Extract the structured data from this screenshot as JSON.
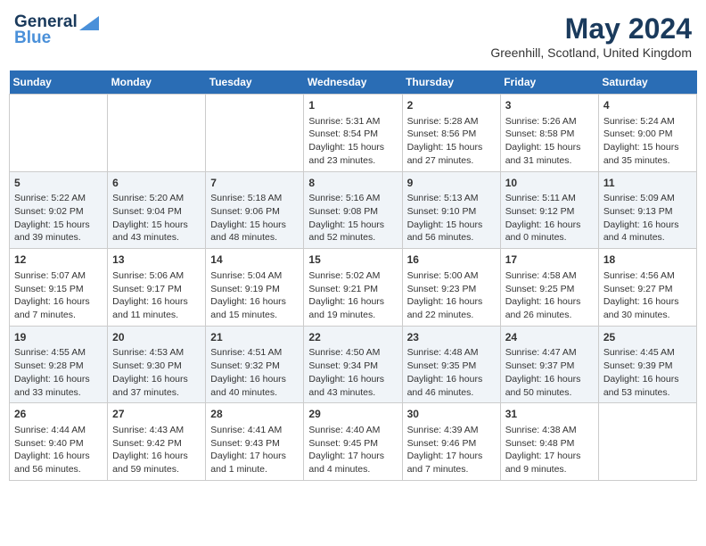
{
  "app": {
    "logo_general": "General",
    "logo_blue": "Blue",
    "title": "May 2024",
    "location": "Greenhill, Scotland, United Kingdom"
  },
  "calendar": {
    "headers": [
      "Sunday",
      "Monday",
      "Tuesday",
      "Wednesday",
      "Thursday",
      "Friday",
      "Saturday"
    ],
    "weeks": [
      [
        {
          "day": "",
          "info": ""
        },
        {
          "day": "",
          "info": ""
        },
        {
          "day": "",
          "info": ""
        },
        {
          "day": "1",
          "info": "Sunrise: 5:31 AM\nSunset: 8:54 PM\nDaylight: 15 hours\nand 23 minutes."
        },
        {
          "day": "2",
          "info": "Sunrise: 5:28 AM\nSunset: 8:56 PM\nDaylight: 15 hours\nand 27 minutes."
        },
        {
          "day": "3",
          "info": "Sunrise: 5:26 AM\nSunset: 8:58 PM\nDaylight: 15 hours\nand 31 minutes."
        },
        {
          "day": "4",
          "info": "Sunrise: 5:24 AM\nSunset: 9:00 PM\nDaylight: 15 hours\nand 35 minutes."
        }
      ],
      [
        {
          "day": "5",
          "info": "Sunrise: 5:22 AM\nSunset: 9:02 PM\nDaylight: 15 hours\nand 39 minutes."
        },
        {
          "day": "6",
          "info": "Sunrise: 5:20 AM\nSunset: 9:04 PM\nDaylight: 15 hours\nand 43 minutes."
        },
        {
          "day": "7",
          "info": "Sunrise: 5:18 AM\nSunset: 9:06 PM\nDaylight: 15 hours\nand 48 minutes."
        },
        {
          "day": "8",
          "info": "Sunrise: 5:16 AM\nSunset: 9:08 PM\nDaylight: 15 hours\nand 52 minutes."
        },
        {
          "day": "9",
          "info": "Sunrise: 5:13 AM\nSunset: 9:10 PM\nDaylight: 15 hours\nand 56 minutes."
        },
        {
          "day": "10",
          "info": "Sunrise: 5:11 AM\nSunset: 9:12 PM\nDaylight: 16 hours\nand 0 minutes."
        },
        {
          "day": "11",
          "info": "Sunrise: 5:09 AM\nSunset: 9:13 PM\nDaylight: 16 hours\nand 4 minutes."
        }
      ],
      [
        {
          "day": "12",
          "info": "Sunrise: 5:07 AM\nSunset: 9:15 PM\nDaylight: 16 hours\nand 7 minutes."
        },
        {
          "day": "13",
          "info": "Sunrise: 5:06 AM\nSunset: 9:17 PM\nDaylight: 16 hours\nand 11 minutes."
        },
        {
          "day": "14",
          "info": "Sunrise: 5:04 AM\nSunset: 9:19 PM\nDaylight: 16 hours\nand 15 minutes."
        },
        {
          "day": "15",
          "info": "Sunrise: 5:02 AM\nSunset: 9:21 PM\nDaylight: 16 hours\nand 19 minutes."
        },
        {
          "day": "16",
          "info": "Sunrise: 5:00 AM\nSunset: 9:23 PM\nDaylight: 16 hours\nand 22 minutes."
        },
        {
          "day": "17",
          "info": "Sunrise: 4:58 AM\nSunset: 9:25 PM\nDaylight: 16 hours\nand 26 minutes."
        },
        {
          "day": "18",
          "info": "Sunrise: 4:56 AM\nSunset: 9:27 PM\nDaylight: 16 hours\nand 30 minutes."
        }
      ],
      [
        {
          "day": "19",
          "info": "Sunrise: 4:55 AM\nSunset: 9:28 PM\nDaylight: 16 hours\nand 33 minutes."
        },
        {
          "day": "20",
          "info": "Sunrise: 4:53 AM\nSunset: 9:30 PM\nDaylight: 16 hours\nand 37 minutes."
        },
        {
          "day": "21",
          "info": "Sunrise: 4:51 AM\nSunset: 9:32 PM\nDaylight: 16 hours\nand 40 minutes."
        },
        {
          "day": "22",
          "info": "Sunrise: 4:50 AM\nSunset: 9:34 PM\nDaylight: 16 hours\nand 43 minutes."
        },
        {
          "day": "23",
          "info": "Sunrise: 4:48 AM\nSunset: 9:35 PM\nDaylight: 16 hours\nand 46 minutes."
        },
        {
          "day": "24",
          "info": "Sunrise: 4:47 AM\nSunset: 9:37 PM\nDaylight: 16 hours\nand 50 minutes."
        },
        {
          "day": "25",
          "info": "Sunrise: 4:45 AM\nSunset: 9:39 PM\nDaylight: 16 hours\nand 53 minutes."
        }
      ],
      [
        {
          "day": "26",
          "info": "Sunrise: 4:44 AM\nSunset: 9:40 PM\nDaylight: 16 hours\nand 56 minutes."
        },
        {
          "day": "27",
          "info": "Sunrise: 4:43 AM\nSunset: 9:42 PM\nDaylight: 16 hours\nand 59 minutes."
        },
        {
          "day": "28",
          "info": "Sunrise: 4:41 AM\nSunset: 9:43 PM\nDaylight: 17 hours\nand 1 minute."
        },
        {
          "day": "29",
          "info": "Sunrise: 4:40 AM\nSunset: 9:45 PM\nDaylight: 17 hours\nand 4 minutes."
        },
        {
          "day": "30",
          "info": "Sunrise: 4:39 AM\nSunset: 9:46 PM\nDaylight: 17 hours\nand 7 minutes."
        },
        {
          "day": "31",
          "info": "Sunrise: 4:38 AM\nSunset: 9:48 PM\nDaylight: 17 hours\nand 9 minutes."
        },
        {
          "day": "",
          "info": ""
        }
      ]
    ]
  }
}
